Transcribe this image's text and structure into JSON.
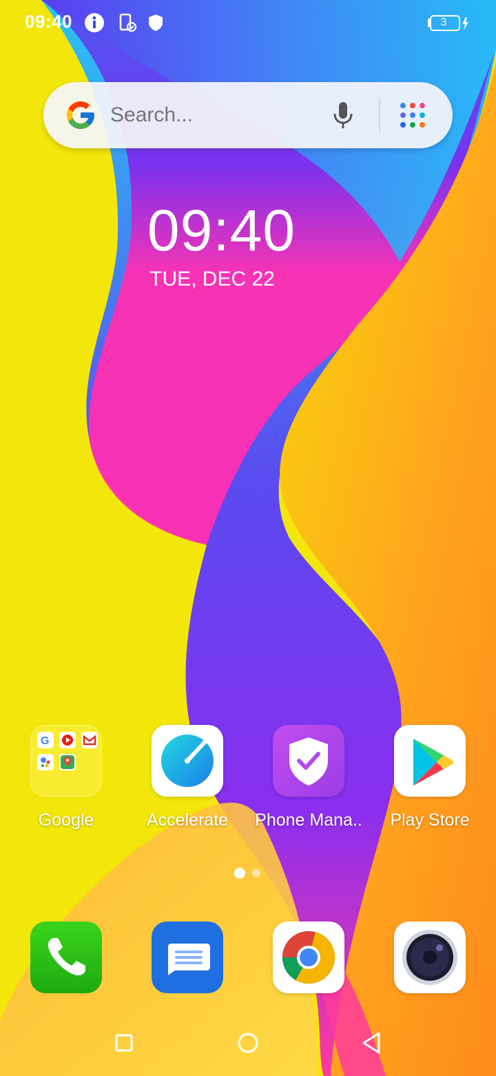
{
  "status_bar": {
    "time": "09:40",
    "battery_level": "3",
    "icons": [
      "info-icon",
      "phone-screen-icon",
      "shield-icon",
      "battery-icon",
      "charging-icon"
    ]
  },
  "search": {
    "placeholder": "Search..."
  },
  "clock": {
    "time": "09:40",
    "date": "TUE, DEC 22"
  },
  "apps": [
    {
      "label": "Google"
    },
    {
      "label": "Accelerate"
    },
    {
      "label": "Phone Mana.."
    },
    {
      "label": "Play Store"
    }
  ],
  "dock": [
    {
      "icon": "phone-icon"
    },
    {
      "icon": "messages-icon"
    },
    {
      "icon": "chrome-icon"
    },
    {
      "icon": "camera-icon"
    }
  ],
  "pages": {
    "count": 2,
    "current": 1
  },
  "nav": {
    "buttons": [
      "recents-icon",
      "home-icon",
      "back-icon"
    ]
  }
}
